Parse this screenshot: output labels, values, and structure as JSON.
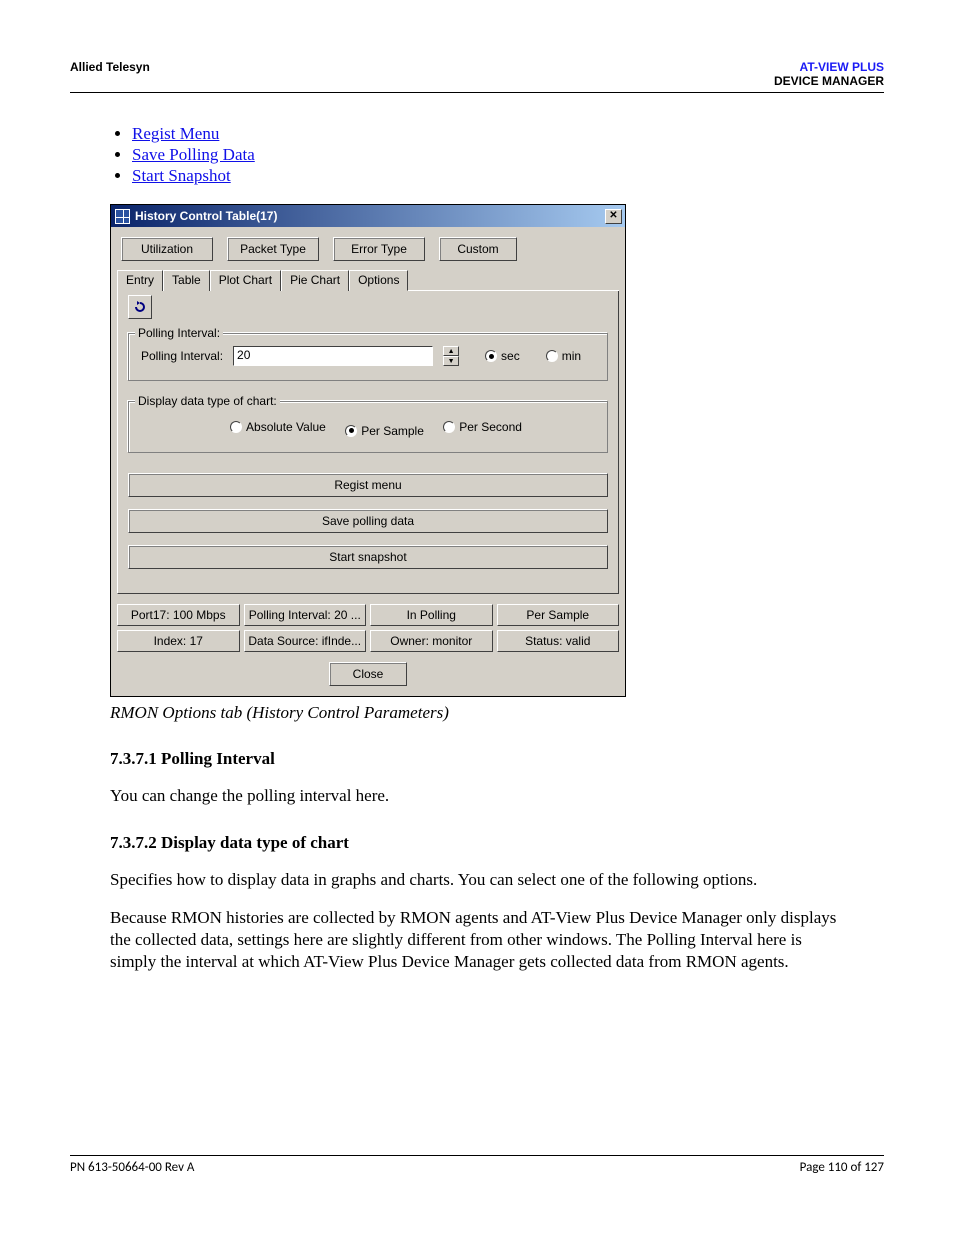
{
  "header": {
    "company": "Allied Telesyn",
    "product": "AT-VIEW PLUS",
    "subtitle": "DEVICE MANAGER"
  },
  "links": [
    "Regist Menu",
    "Save Polling Data",
    "Start Snapshot"
  ],
  "dialog": {
    "title": "History Control Table(17)",
    "top_buttons": [
      "Utilization",
      "Packet Type",
      "Error Type",
      "Custom"
    ],
    "tabs": [
      "Entry",
      "Table",
      "Plot Chart",
      "Pie Chart",
      "Options"
    ],
    "active_tab": "Options",
    "polling_group": {
      "legend": "Polling Interval:",
      "label": "Polling Interval:",
      "value": "20",
      "unit_sec": "sec",
      "unit_min": "min"
    },
    "display_group": {
      "legend": "Display data type of chart:",
      "options": [
        "Absolute Value",
        "Per Sample",
        "Per Second"
      ],
      "selected": "Per Sample"
    },
    "action_buttons": [
      "Regist menu",
      "Save polling data",
      "Start snapshot"
    ],
    "status": {
      "row1": [
        "Port17: 100 Mbps",
        "Polling Interval: 20 ...",
        "In Polling",
        "Per Sample"
      ],
      "row2": [
        "Index: 17",
        "Data Source: ifInde...",
        "Owner: monitor",
        "Status: valid"
      ]
    },
    "close": "Close"
  },
  "caption": "RMON Options tab (History Control Parameters)",
  "sections": {
    "s1_title": "7.3.7.1 Polling Interval",
    "s1_body": "You can change the polling interval here.",
    "s2_title": "7.3.7.2 Display data type of chart",
    "s2_body1": "Specifies how to display data in graphs and charts. You can select one of the following options.",
    "s2_body2": "Because RMON histories are collected by RMON agents and AT-View Plus Device Manager only displays the collected data, settings here are slightly different from other windows. The Polling Interval here is simply the interval at which AT-View Plus Device Manager gets collected data from RMON agents."
  },
  "footer": {
    "left": "PN 613-50664-00 Rev A",
    "right": "Page 110 of 127"
  }
}
